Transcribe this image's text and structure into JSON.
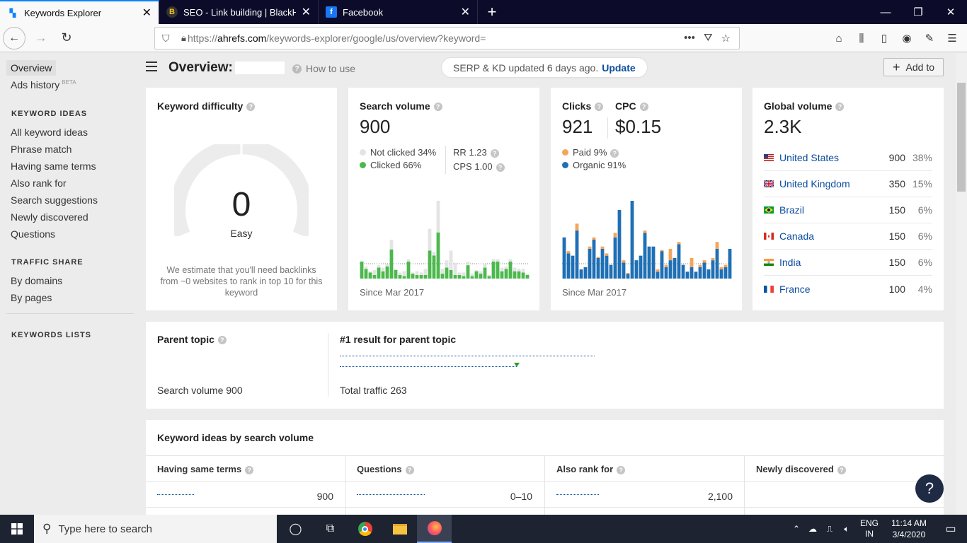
{
  "browser": {
    "tabs": [
      {
        "label": "Keywords Explorer",
        "active": true
      },
      {
        "label": "SEO - Link building | BlackHatW",
        "active": false
      },
      {
        "label": "Facebook",
        "active": false
      }
    ],
    "url_prefix": "https://",
    "url_domain": "ahrefs.com",
    "url_path": "/keywords-explorer/google/us/overview?keyword="
  },
  "sidebar": {
    "overview": "Overview",
    "ads_history": "Ads history",
    "beta": "BETA",
    "keyword_ideas_header": "KEYWORD IDEAS",
    "keyword_ideas": [
      "All keyword ideas",
      "Phrase match",
      "Having same terms",
      "Also rank for",
      "Search suggestions",
      "Newly discovered",
      "Questions"
    ],
    "traffic_share_header": "TRAFFIC SHARE",
    "traffic_share": [
      "By domains",
      "By pages"
    ],
    "keywords_lists_header": "KEYWORDS LISTS"
  },
  "header": {
    "title": "Overview:",
    "how_to_use": "How to use",
    "serp_status": "SERP & KD updated 6 days ago.",
    "update": "Update",
    "add_to": "Add to"
  },
  "kd": {
    "title": "Keyword difficulty",
    "value": "0",
    "label": "Easy",
    "note": "We estimate that you'll need backlinks from ~0 websites to rank in top 10 for this keyword",
    "gauge_fraction": 0
  },
  "search_volume": {
    "title": "Search volume",
    "value": "900",
    "not_clicked": "Not clicked 34%",
    "clicked": "Clicked 66%",
    "rr": "RR 1.23",
    "cps": "CPS 1.00",
    "since": "Since Mar 2017"
  },
  "clicks": {
    "title": "Clicks",
    "value": "921",
    "cpc_title": "CPC",
    "cpc_value": "$0.15",
    "paid": "Paid 9%",
    "organic": "Organic 91%",
    "since": "Since Mar 2017"
  },
  "global_volume": {
    "title": "Global volume",
    "value": "2.3K",
    "countries": [
      {
        "name": "United States",
        "volume": "900",
        "pct": "38%",
        "flag": "us"
      },
      {
        "name": "United Kingdom",
        "volume": "350",
        "pct": "15%",
        "flag": "uk"
      },
      {
        "name": "Brazil",
        "volume": "150",
        "pct": "6%",
        "flag": "br"
      },
      {
        "name": "Canada",
        "volume": "150",
        "pct": "6%",
        "flag": "ca"
      },
      {
        "name": "India",
        "volume": "150",
        "pct": "6%",
        "flag": "in"
      },
      {
        "name": "France",
        "volume": "100",
        "pct": "4%",
        "flag": "fr"
      }
    ]
  },
  "parent_topic": {
    "title": "Parent topic",
    "result_title": "#1 result for parent topic",
    "search_volume": "Search volume 900",
    "total_traffic": "Total traffic 263"
  },
  "keyword_ideas": {
    "title": "Keyword ideas by search volume",
    "columns": [
      {
        "label": "Having same terms",
        "value": "900"
      },
      {
        "label": "Questions",
        "value": "0–10"
      },
      {
        "label": "Also rank for",
        "value": "2,100"
      },
      {
        "label": "Newly discovered",
        "value": ""
      }
    ]
  },
  "taskbar": {
    "search_placeholder": "Type here to search",
    "lang1": "ENG",
    "lang2": "IN",
    "time": "11:14 AM",
    "date": "3/4/2020"
  },
  "help": "?",
  "colors": {
    "accent": "#0b4c9e",
    "clicked": "#4db84d",
    "not_clicked": "#e4e4e4",
    "paid": "#f5a55a",
    "organic": "#1f6fb5"
  },
  "sv_chart": {
    "clicked": [
      14,
      8,
      5,
      3,
      9,
      6,
      10,
      24,
      7,
      3,
      2,
      14,
      4,
      3,
      3,
      3,
      23,
      19,
      38,
      4,
      9,
      7,
      3,
      3,
      2,
      11,
      2,
      6,
      4,
      9,
      2,
      14,
      14,
      6,
      8,
      14,
      6,
      6,
      5,
      3
    ],
    "not_clicked": [
      0,
      2,
      1,
      4,
      2,
      3,
      2,
      8,
      1,
      2,
      4,
      2,
      1,
      3,
      2,
      5,
      18,
      3,
      26,
      4,
      6,
      16,
      10,
      2,
      3,
      3,
      2,
      1,
      2,
      3,
      1,
      2,
      2,
      3,
      2,
      2,
      3,
      2,
      3,
      1
    ]
  },
  "clicks_chart": {
    "organic": [
      36,
      22,
      20,
      42,
      8,
      10,
      26,
      34,
      18,
      26,
      20,
      12,
      36,
      60,
      14,
      4,
      68,
      16,
      20,
      40,
      28,
      28,
      6,
      24,
      10,
      16,
      18,
      30,
      12,
      6,
      10,
      6,
      10,
      14,
      8,
      16,
      26,
      8,
      10,
      26
    ],
    "paid": [
      0,
      2,
      0,
      6,
      0,
      0,
      2,
      2,
      1,
      2,
      2,
      0,
      4,
      0,
      2,
      1,
      0,
      0,
      0,
      2,
      0,
      0,
      2,
      1,
      2,
      10,
      0,
      2,
      0,
      0,
      8,
      0,
      2,
      2,
      0,
      2,
      6,
      2,
      2,
      0
    ]
  }
}
